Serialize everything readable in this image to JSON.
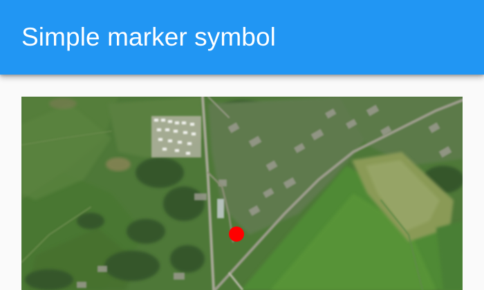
{
  "app_bar": {
    "title": "Simple marker symbol",
    "color": "#2196f3"
  },
  "map": {
    "basemap": "imagery",
    "marker": {
      "style": "circle",
      "color": "#ff0000"
    }
  }
}
